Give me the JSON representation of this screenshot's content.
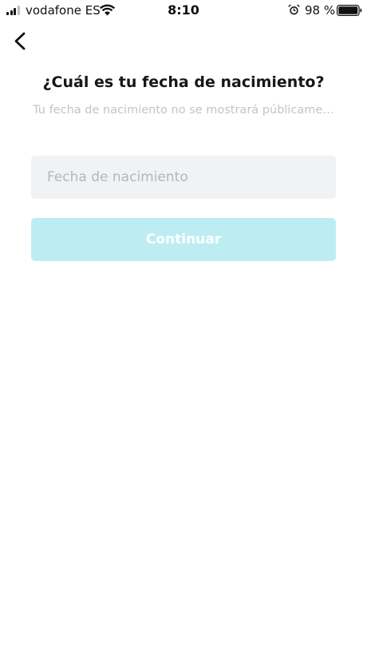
{
  "status_bar": {
    "carrier": "vodafone ES",
    "time": "8:10",
    "battery_percent": "98 %",
    "signal_icon": "cellular-signal-icon",
    "wifi_icon": "wifi-icon",
    "alarm_icon": "alarm-clock-icon",
    "battery_icon": "battery-icon"
  },
  "nav": {
    "back_icon": "chevron-left-icon"
  },
  "header": {
    "title": "¿Cuál es tu fecha de nacimiento?",
    "subtitle": "Tu fecha de nacimiento no se mostrará públicame…"
  },
  "form": {
    "birthdate_placeholder": "Fecha de nacimiento",
    "birthdate_value": "",
    "continue_label": "Continuar",
    "continue_color": "#bdedf3"
  }
}
